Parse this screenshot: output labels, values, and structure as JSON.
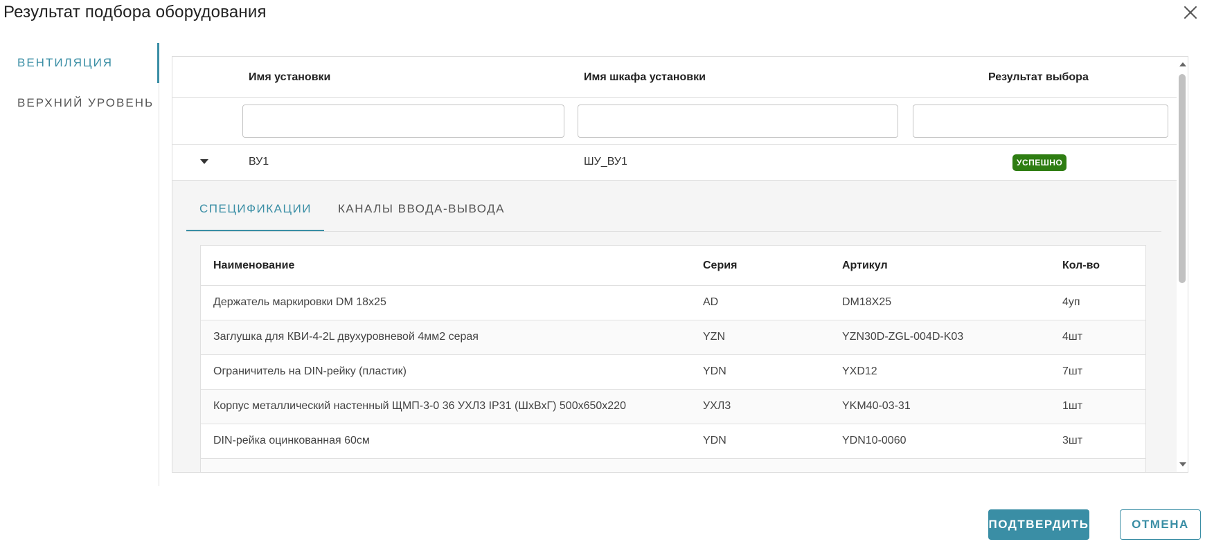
{
  "dialog": {
    "title": "Результат подбора оборудования",
    "close_icon": "close-icon"
  },
  "sidebar": {
    "items": [
      {
        "label": "ВЕНТИЛЯЦИЯ",
        "active": true
      },
      {
        "label": "ВЕРХНИЙ УРОВЕНЬ",
        "active": false
      }
    ]
  },
  "main_table": {
    "columns": [
      "Имя установки",
      "Имя шкафа установки",
      "Результат выбора"
    ],
    "filters": [
      "",
      "",
      ""
    ],
    "rows": [
      {
        "expand_icon": "caret-down-icon",
        "name": "ВУ1",
        "cabinet": "ШУ_ВУ1",
        "result": "УСПЕШНО",
        "result_color": "#2e7d12"
      }
    ]
  },
  "detail": {
    "tabs": [
      {
        "label": "СПЕЦИФИКАЦИИ",
        "active": true
      },
      {
        "label": "КАНАЛЫ ВВОДА-ВЫВОДА",
        "active": false
      }
    ],
    "spec_columns": [
      "Наименование",
      "Серия",
      "Артикул",
      "Кол-во"
    ],
    "spec_rows": [
      [
        "Держатель маркировки DM 18x25",
        "AD",
        "DM18X25",
        "4уп"
      ],
      [
        "Заглушка для КВИ-4-2L двухуровневой 4мм2 серая",
        "YZN",
        "YZN30D-ZGL-004D-K03",
        "4шт"
      ],
      [
        "Ограничитель на DIN-рейку (пластик)",
        "YDN",
        "YXD12",
        "7шт"
      ],
      [
        "Корпус металлический настенный ЩМП-3-0 36 УХЛ3 IP31 (ШхВхГ) 500х650х220",
        "УХЛ3",
        "YKM40-03-31",
        "1шт"
      ],
      [
        "DIN-рейка оцинкованная 60см",
        "YDN",
        "YDN10-0060",
        "3шт"
      ]
    ]
  },
  "actions": {
    "confirm": "ПОДТВЕРДИТЬ",
    "cancel": "ОТМЕНА"
  },
  "colors": {
    "accent": "#3a8ea5",
    "success": "#2e7d12"
  }
}
